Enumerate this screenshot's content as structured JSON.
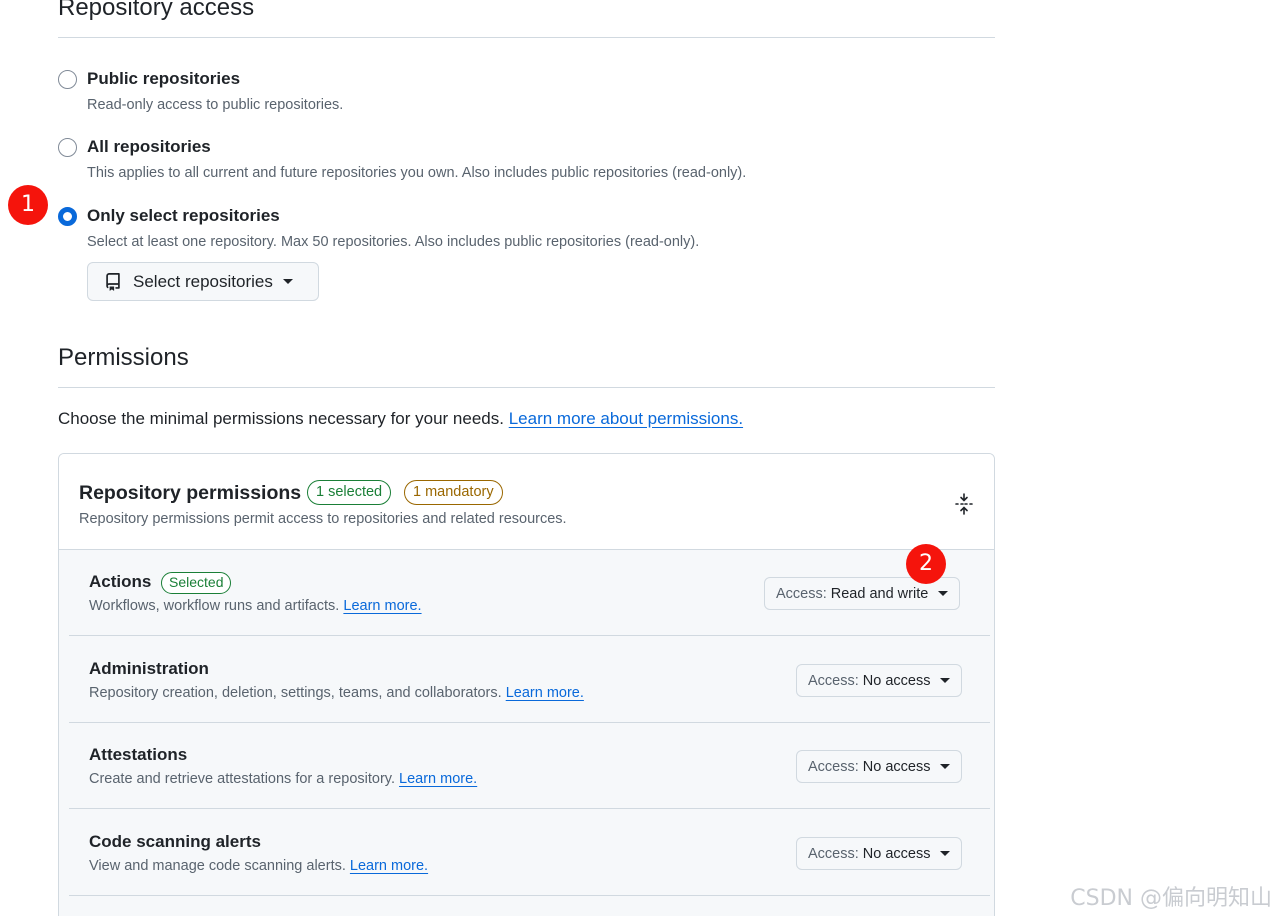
{
  "repository_access": {
    "title": "Repository access",
    "options": [
      {
        "label": "Public repositories",
        "description": "Read-only access to public repositories.",
        "checked": false
      },
      {
        "label": "All repositories",
        "description": "This applies to all current and future repositories you own. Also includes public repositories (read-only).",
        "checked": false
      },
      {
        "label": "Only select repositories",
        "description": "Select at least one repository. Max 50 repositories. Also includes public repositories (read-only).",
        "checked": true
      }
    ],
    "select_button": {
      "label": "Select repositories",
      "icon": "repo-icon"
    }
  },
  "callouts": {
    "first": "1",
    "second": "2"
  },
  "permissions": {
    "title": "Permissions",
    "intro": "Choose the minimal permissions necessary for your needs.",
    "intro_link": "Learn more about permissions.",
    "repository_permissions": {
      "title": "Repository permissions",
      "selected_badge": "1 selected",
      "mandatory_badge": "1 mandatory",
      "description": "Repository permissions permit access to repositories and related resources.",
      "collapse_icon": "fold-icon",
      "items": [
        {
          "name": "Actions",
          "badge": "Selected",
          "description": "Workflows, workflow runs and artifacts.",
          "link": "Learn more.",
          "access_prefix": "Access:",
          "access_value": "Read and write"
        },
        {
          "name": "Administration",
          "description": "Repository creation, deletion, settings, teams, and collaborators.",
          "link": "Learn more.",
          "access_prefix": "Access:",
          "access_value": "No access"
        },
        {
          "name": "Attestations",
          "description": "Create and retrieve attestations for a repository.",
          "link": "Learn more.",
          "access_prefix": "Access:",
          "access_value": "No access"
        },
        {
          "name": "Code scanning alerts",
          "description": "View and manage code scanning alerts.",
          "link": "Learn more.",
          "access_prefix": "Access:",
          "access_value": "No access"
        }
      ]
    }
  },
  "watermark": "CSDN @偏向明知山",
  "colors": {
    "accent": "#0969da",
    "success": "#1a7f37",
    "attention": "#9a6700",
    "callout": "#f5140c"
  }
}
